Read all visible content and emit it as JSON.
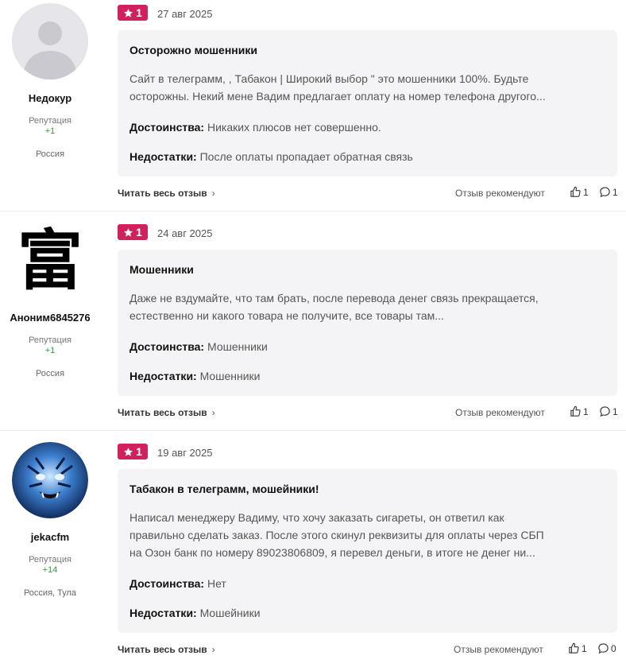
{
  "reviews": [
    {
      "author": "Недокур",
      "reputation_label": "Репутация",
      "reputation_value": "+1",
      "location": "Россия",
      "avatar": "default-avatar",
      "rating": "1",
      "date": "27 авг 2025",
      "title": "Осторожно мошенники",
      "text_lines": [
        "Сайт в телеграмм, , Табакон | Широкий выбор \" это мошенники 100%. Будьте",
        "осторожны. Некий мене Вадим предлагает оплату на номер телефона другого..."
      ],
      "pros_label": "Достоинства:",
      "pros": "Никаких плюсов нет совершенно.",
      "cons_label": "Недостатки:",
      "cons": "После оплаты пропадает обратная связь",
      "read_more": "Читать весь отзыв",
      "recommend_label": "Отзыв рекомендуют",
      "likes": "1",
      "comments": "1"
    },
    {
      "author": "Аноним6845276",
      "reputation_label": "Репутация",
      "reputation_value": "+1",
      "location": "Россия",
      "avatar": "hanzi-avatar",
      "avatar_glyph": "富",
      "rating": "1",
      "date": "24 авг 2025",
      "title": "Мошенники",
      "text_lines": [
        "Даже не вздумайте, что там брать, после перевода денег связь прекращается,",
        "естественно ни какого товара не получите, все товары там..."
      ],
      "pros_label": "Достоинства:",
      "pros": "Мошенники",
      "cons_label": "Недостатки:",
      "cons": "Мошенники",
      "read_more": "Читать весь отзыв",
      "recommend_label": "Отзыв рекомендуют",
      "likes": "1",
      "comments": "1"
    },
    {
      "author": "jekacfm",
      "reputation_label": "Репутация",
      "reputation_value": "+14",
      "location": "Россия, Тула",
      "avatar": "tiger-avatar",
      "rating": "1",
      "date": "19 авг 2025",
      "title": "Табакон в телеграмм, мошейники!",
      "text_lines": [
        "Написал менеджеру Вадиму, что хочу заказать сигареты, он ответил как",
        "правильно сделать заказ. После этого скинул реквизиты для оплаты через СБП",
        "на Озон банк по номеру 89023806809, я перевел деньги, в итоге не денег ни..."
      ],
      "pros_label": "Достоинства:",
      "pros": "Нет",
      "cons_label": "Недостатки:",
      "cons": "Мошейники",
      "read_more": "Читать весь отзыв",
      "recommend_label": "Отзыв рекомендуют",
      "likes": "1",
      "comments": "0"
    }
  ],
  "colors": {
    "rating_badge": "#d0215c",
    "reputation_positive": "#2e9e3e",
    "card_background": "#f4f4f6"
  }
}
